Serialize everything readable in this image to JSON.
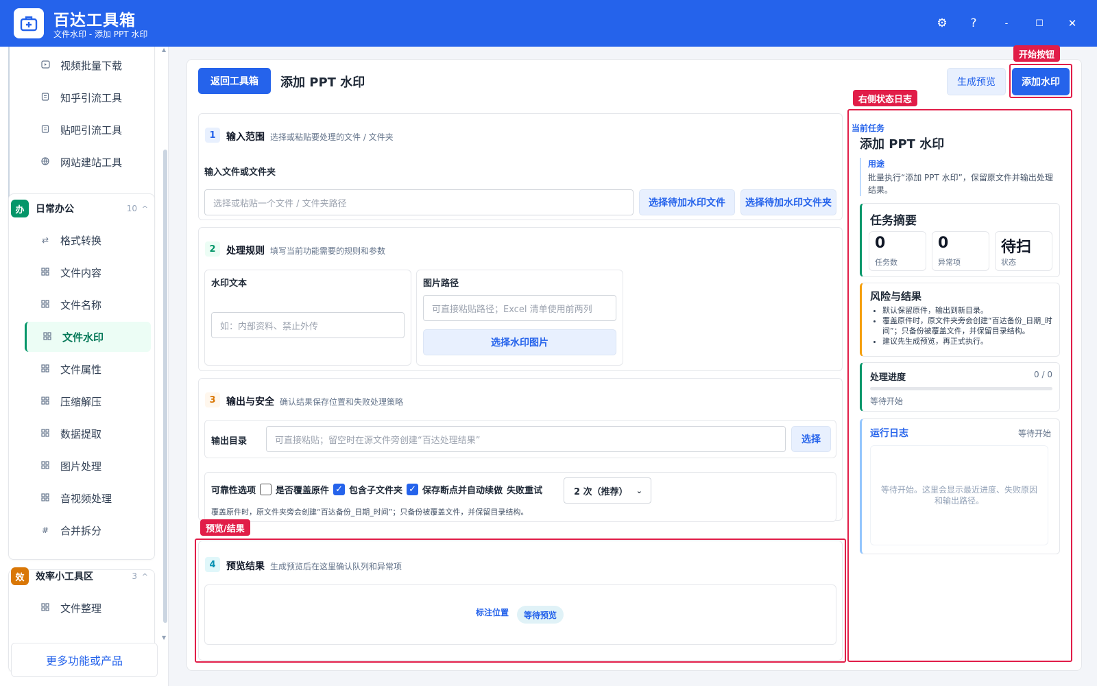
{
  "app": {
    "title": "百达工具箱",
    "subtitle": "文件水印 - 添加 PPT 水印"
  },
  "window": {
    "settings": "⚙",
    "help": "?",
    "minimize": "-",
    "maximize": "☐",
    "close": "✕"
  },
  "sidebar": {
    "top_items": [
      {
        "label": "视频批量下载",
        "icon": "video-icon"
      },
      {
        "label": "知乎引流工具",
        "icon": "doc-icon"
      },
      {
        "label": "贴吧引流工具",
        "icon": "doc-icon"
      },
      {
        "label": "网站建站工具",
        "icon": "globe-icon"
      }
    ],
    "group1": {
      "badge": "办",
      "title": "日常办公",
      "count": "10",
      "color": "#059669"
    },
    "group1_items": [
      {
        "label": "格式转换",
        "icon": "⇄"
      },
      {
        "label": "文件内容",
        "icon": "grid"
      },
      {
        "label": "文件名称",
        "icon": "grid"
      },
      {
        "label": "文件水印",
        "icon": "grid",
        "active": true
      },
      {
        "label": "文件属性",
        "icon": "grid"
      },
      {
        "label": "压缩解压",
        "icon": "grid"
      },
      {
        "label": "数据提取",
        "icon": "grid"
      },
      {
        "label": "图片处理",
        "icon": "grid"
      },
      {
        "label": "音视频处理",
        "icon": "grid"
      },
      {
        "label": "合并拆分",
        "icon": "#"
      }
    ],
    "group2": {
      "badge": "效",
      "title": "效率小工具区",
      "count": "3",
      "color": "#d97706"
    },
    "group2_items": [
      {
        "label": "文件整理",
        "icon": "grid"
      }
    ],
    "more": "更多功能或产品"
  },
  "header": {
    "back": "返回工具箱",
    "title": "添加 PPT 水印",
    "preview": "生成预览",
    "start": "添加水印"
  },
  "annotations": {
    "start": "开始按钮",
    "log": "右侧状态日志",
    "preview": "预览/结果"
  },
  "s1": {
    "num": "1",
    "title": "输入范围",
    "desc": "选择或粘贴要处理的文件 / 文件夹",
    "label": "输入文件或文件夹",
    "placeholder": "选择或粘贴一个文件 / 文件夹路径",
    "btn_file": "选择待加水印文件",
    "btn_folder": "选择待加水印文件夹"
  },
  "s2": {
    "num": "2",
    "title": "处理规则",
    "desc": "填写当前功能需要的规则和参数",
    "wm_label": "水印文本",
    "wm_placeholder": "如：内部资料、禁止外传",
    "img_label": "图片路径",
    "img_placeholder": "可直接粘贴路径；Excel 清单使用前两列",
    "img_btn": "选择水印图片"
  },
  "s3": {
    "num": "3",
    "title": "输出与安全",
    "desc": "确认结果保存位置和失败处理策略",
    "out_label": "输出目录",
    "out_placeholder": "可直接粘贴；留空时在源文件旁创建“百达处理结果”",
    "out_btn": "选择",
    "opt_label": "可靠性选项",
    "opt_overwrite": "是否覆盖原件",
    "opt_sub": "包含子文件夹",
    "opt_resume": "保存断点并自动续做",
    "retry_label": "失败重试",
    "retry_value": "2 次（推荐）",
    "note": "覆盖原件时，原文件夹旁会创建“百达备份_日期_时间”；只备份被覆盖文件，并保留目录结构。"
  },
  "s4": {
    "num": "4",
    "title": "预览结果",
    "desc": "生成预览后在这里确认队列和异常项",
    "mark": "标注位置",
    "wait": "等待预览"
  },
  "right": {
    "cur_label": "当前任务",
    "cur_title": "添加 PPT 水印",
    "use_label": "用途",
    "use_text": "批量执行“添加 PPT 水印”，保留原文件并输出处理结果。",
    "summary_title": "任务摘要",
    "stats": [
      {
        "v": "0",
        "l": "任务数"
      },
      {
        "v": "0",
        "l": "异常项"
      },
      {
        "v": "待扫",
        "l": "状态"
      }
    ],
    "risk_title": "风险与结果",
    "risks": [
      "默认保留原件，输出到新目录。",
      "覆盖原件时，原文件夹旁会创建“百达备份_日期_时间”；只备份被覆盖文件，并保留目录结构。",
      "建议先生成预览，再正式执行。"
    ],
    "progress_title": "处理进度",
    "progress_value": "0 / 0",
    "progress_fraction": 0,
    "progress_status": "等待开始",
    "log_title": "运行日志",
    "log_status": "等待开始",
    "log_empty": "等待开始。这里会显示最近进度、失败原因和输出路径。"
  }
}
